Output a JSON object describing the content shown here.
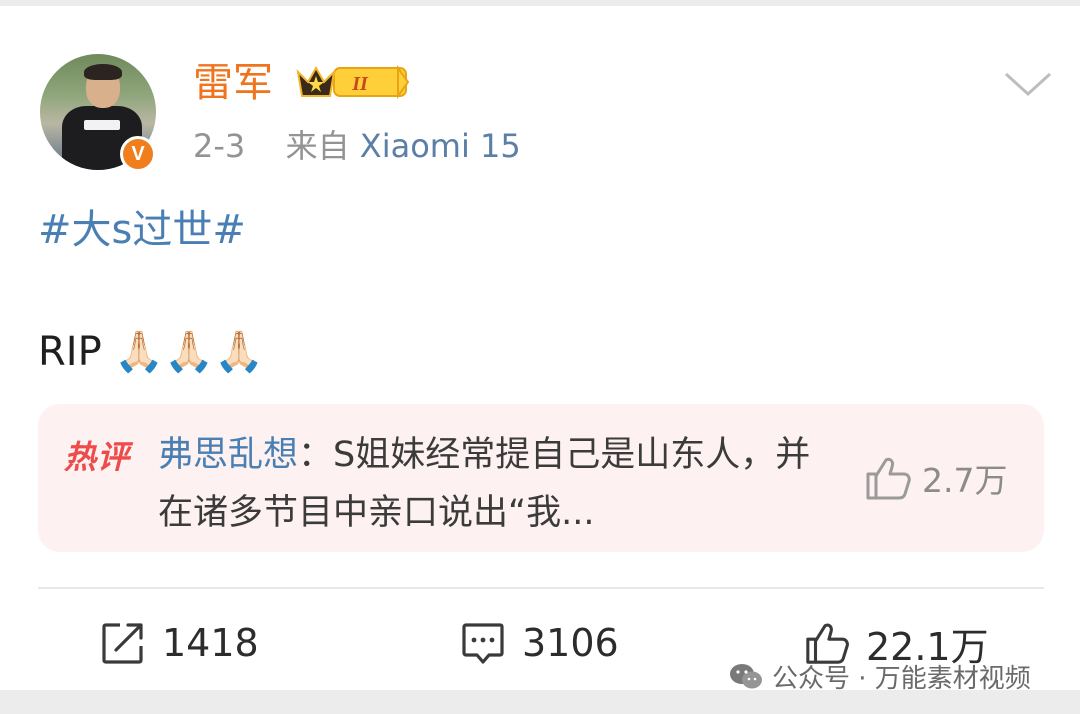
{
  "post": {
    "username": "雷军",
    "vip_level": "II",
    "date": "2-3",
    "source_prefix": "来自",
    "source_device": "Xiaomi 15",
    "hashtag": "#大s过世#",
    "text": "RIP 🙏🏻🙏🏻🙏🏻"
  },
  "hot_comment": {
    "tag": "热评",
    "commenter": "弗思乱想",
    "separator": "：",
    "text": "S姐妹经常提自己是山东人，并在诸多节目中亲口说出“我...",
    "likes": "2.7万"
  },
  "actions": {
    "reposts": "1418",
    "comments": "3106",
    "likes": "22.1万"
  },
  "watermark": {
    "text": "公众号 · 万能素材视频"
  },
  "colors": {
    "username": "#f0731e",
    "link": "#4a7fb3",
    "hot_tag": "#ee4b4b",
    "hot_background": "#fdf1f1"
  },
  "icons": {
    "verified": "verified-v-icon",
    "vip": "crown-badge-icon",
    "menu": "chevron-down-icon",
    "repost": "repost-icon",
    "comment": "comment-icon",
    "like": "thumbs-up-icon"
  }
}
